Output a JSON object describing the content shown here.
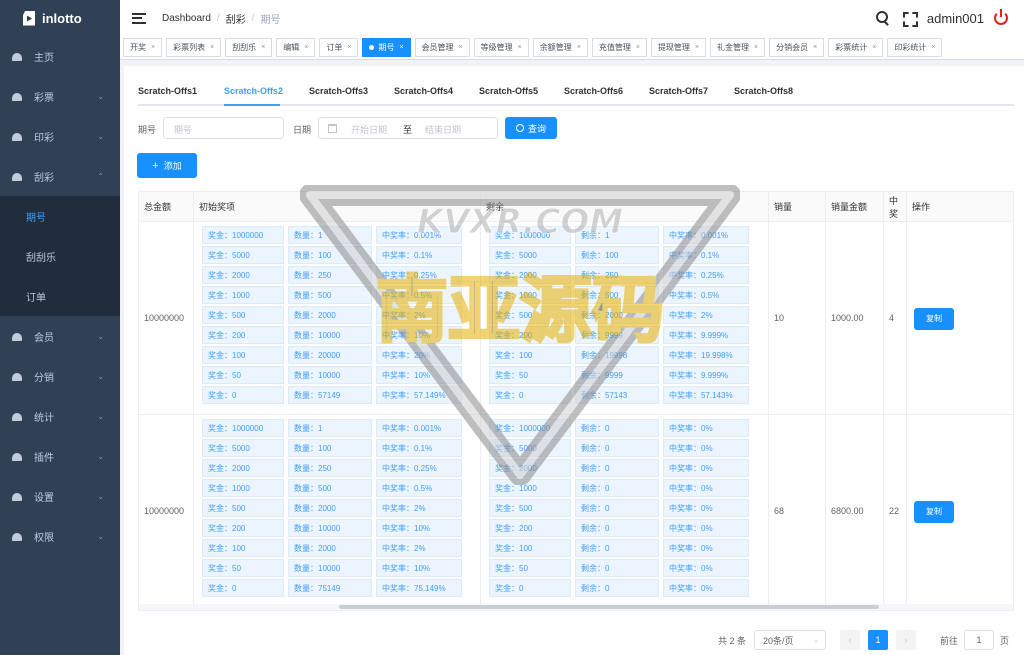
{
  "app": {
    "name": "inlotto"
  },
  "sidebar": {
    "items": [
      {
        "label": "主页"
      },
      {
        "label": "彩票"
      },
      {
        "label": "印彩"
      },
      {
        "label": "刮彩",
        "sub": [
          {
            "label": "期号"
          },
          {
            "label": "刮刮乐"
          },
          {
            "label": "订单"
          }
        ]
      },
      {
        "label": "会员"
      },
      {
        "label": "分销"
      },
      {
        "label": "统计"
      },
      {
        "label": "插件"
      },
      {
        "label": "设置"
      },
      {
        "label": "权限"
      }
    ]
  },
  "header": {
    "breadcrumb": [
      "Dashboard",
      "刮彩",
      "期号"
    ],
    "username": "admin001"
  },
  "tags": [
    "开奖",
    "彩票列表",
    "刮刮乐",
    "编辑",
    "订单",
    "期号",
    "会员管理",
    "等级管理",
    "余额管理",
    "充值管理",
    "提现管理",
    "礼金管理",
    "分销会员",
    "彩票统计",
    "印彩统计"
  ],
  "active_tag": "期号",
  "tabs": [
    "Scratch-Offs1",
    "Scratch-Offs2",
    "Scratch-Offs3",
    "Scratch-Offs4",
    "Scratch-Offs5",
    "Scratch-Offs6",
    "Scratch-Offs7",
    "Scratch-Offs8"
  ],
  "active_tab": "Scratch-Offs2",
  "filters": {
    "issue_label": "期号",
    "issue_placeholder": "期号",
    "date_label": "日期",
    "start_placeholder": "开始日期",
    "range_sep": "至",
    "end_placeholder": "结束日期",
    "search_button": "查询"
  },
  "add_button": "添加",
  "table": {
    "headers": [
      "总金额",
      "初始奖项",
      "剩余",
      "销量",
      "销量金额",
      "中奖",
      "操作"
    ],
    "rows": [
      {
        "total": "10000000",
        "initial": [
          [
            "奖金：1000000",
            "数量：1",
            "中奖率：0.001%"
          ],
          [
            "奖金：5000",
            "数量：100",
            "中奖率：0.1%"
          ],
          [
            "奖金：2000",
            "数量：250",
            "中奖率：0.25%"
          ],
          [
            "奖金：1000",
            "数量：500",
            "中奖率：0.5%"
          ],
          [
            "奖金：500",
            "数量：2000",
            "中奖率：2%"
          ],
          [
            "奖金：200",
            "数量：10000",
            "中奖率：10%"
          ],
          [
            "奖金：100",
            "数量：20000",
            "中奖率：20%"
          ],
          [
            "奖金：50",
            "数量：10000",
            "中奖率：10%"
          ],
          [
            "奖金：0",
            "数量：57149",
            "中奖率：57.149%"
          ]
        ],
        "remaining": [
          [
            "奖金：1000000",
            "剩余：1",
            "中奖率：0.001%"
          ],
          [
            "奖金：5000",
            "剩余：100",
            "中奖率：0.1%"
          ],
          [
            "奖金：2000",
            "剩余：250",
            "中奖率：0.25%"
          ],
          [
            "奖金：1000",
            "剩余：500",
            "中奖率：0.5%"
          ],
          [
            "奖金：500",
            "剩余：2000",
            "中奖率：2%"
          ],
          [
            "奖金：200",
            "剩余：9999",
            "中奖率：9.999%"
          ],
          [
            "奖金：100",
            "剩余：19998",
            "中奖率：19.998%"
          ],
          [
            "奖金：50",
            "剩余：9999",
            "中奖率：9.999%"
          ],
          [
            "奖金：0",
            "剩余：57143",
            "中奖率：57.143%"
          ]
        ],
        "sales": "10",
        "sales_amount": "1000.00",
        "wins": "4",
        "action": "复制"
      },
      {
        "total": "10000000",
        "initial": [
          [
            "奖金：1000000",
            "数量：1",
            "中奖率：0.001%"
          ],
          [
            "奖金：5000",
            "数量：100",
            "中奖率：0.1%"
          ],
          [
            "奖金：2000",
            "数量：250",
            "中奖率：0.25%"
          ],
          [
            "奖金：1000",
            "数量：500",
            "中奖率：0.5%"
          ],
          [
            "奖金：500",
            "数量：2000",
            "中奖率：2%"
          ],
          [
            "奖金：200",
            "数量：10000",
            "中奖率：10%"
          ],
          [
            "奖金：100",
            "数量：2000",
            "中奖率：2%"
          ],
          [
            "奖金：50",
            "数量：10000",
            "中奖率：10%"
          ],
          [
            "奖金：0",
            "数量：75149",
            "中奖率：75.149%"
          ]
        ],
        "remaining": [
          [
            "奖金：1000000",
            "剩余：0",
            "中奖率：0%"
          ],
          [
            "奖金：5000",
            "剩余：0",
            "中奖率：0%"
          ],
          [
            "奖金：2000",
            "剩余：0",
            "中奖率：0%"
          ],
          [
            "奖金：1000",
            "剩余：0",
            "中奖率：0%"
          ],
          [
            "奖金：500",
            "剩余：0",
            "中奖率：0%"
          ],
          [
            "奖金：200",
            "剩余：0",
            "中奖率：0%"
          ],
          [
            "奖金：100",
            "剩余：0",
            "中奖率：0%"
          ],
          [
            "奖金：50",
            "剩余：0",
            "中奖率：0%"
          ],
          [
            "奖金：0",
            "剩余：0",
            "中奖率：0%"
          ]
        ],
        "sales": "68",
        "sales_amount": "6800.00",
        "wins": "22",
        "action": "复制"
      }
    ]
  },
  "pagination": {
    "total": "共 2 条",
    "page_size": "20条/页",
    "current_page": "1",
    "goto_label": "前往",
    "goto_value": "1",
    "page_suffix": "页"
  },
  "watermark": {
    "site": "KVXR.COM",
    "title": "南亚源码"
  },
  "colors": {
    "primary": "#1890ff",
    "sidebar": "#304156",
    "danger": "#e0221e"
  }
}
